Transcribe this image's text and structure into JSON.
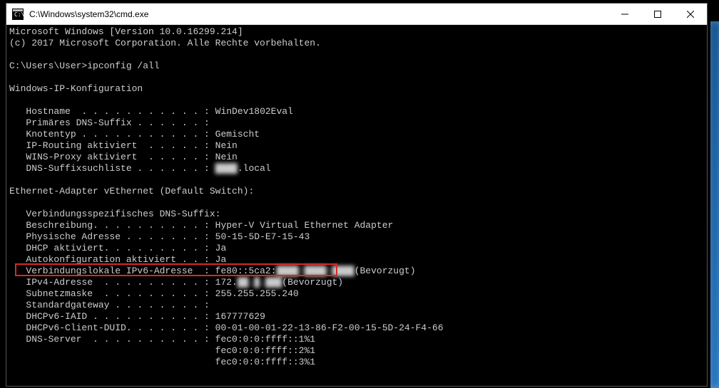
{
  "window": {
    "title": "C:\\Windows\\system32\\cmd.exe"
  },
  "console": {
    "header1": "Microsoft Windows [Version 10.0.16299.214]",
    "header2": "(c) 2017 Microsoft Corporation. Alle Rechte vorbehalten.",
    "prompt_line": "C:\\Users\\User>ipconfig /all",
    "section1_title": "Windows-IP-Konfiguration",
    "hostname_label": "   Hostname  . . . . . . . . . . . : ",
    "hostname_value": "WinDev1802Eval",
    "dns_suffix_label": "   Primäres DNS-Suffix . . . . . . :",
    "nodetype_label": "   Knotentyp . . . . . . . . . . . : ",
    "nodetype_value": "Gemischt",
    "iprouting_label": "   IP-Routing aktiviert  . . . . . : ",
    "iprouting_value": "Nein",
    "winsproxy_label": "   WINS-Proxy aktiviert  . . . . . : ",
    "winsproxy_value": "Nein",
    "dnssuffixlist_label": "   DNS-Suffixsuchliste . . . . . . : ",
    "dnssuffixlist_blur": "████",
    "dnssuffixlist_value": ".local",
    "section2_title": "Ethernet-Adapter vEthernet (Default Switch):",
    "connspec_label": "   Verbindungsspezifisches DNS-Suffix:",
    "desc_label": "   Beschreibung. . . . . . . . . . : ",
    "desc_value": "Hyper-V Virtual Ethernet Adapter",
    "physaddr_label": "   Physische Adresse . . . . . . . : ",
    "physaddr_value": "50-15-5D-E7-15-43",
    "dhcp_label": "   DHCP aktiviert. . . . . . . . . : ",
    "dhcp_value": "Ja",
    "autoconf_label": "   Autokonfiguration aktiviert . . : ",
    "autoconf_value": "Ja",
    "ipv6_label": "   Verbindungslokale IPv6-Adresse  : ",
    "ipv6_prefix": "fe80::5ca2:",
    "ipv6_blur": "████:████:████",
    "ipv6_suffix": "(Bevorzugt)",
    "ipv4_label": "   IPv4-Adresse  . . . . . . . . . : ",
    "ipv4_prefix": "172.",
    "ipv4_blur": "██.█.███",
    "ipv4_suffix": "(Bevorzugt)",
    "subnet_label": "   Subnetzmaske  . . . . . . . . . : ",
    "subnet_value": "255.255.255.240",
    "gateway_label": "   Standardgateway . . . . . . . . :",
    "iaid_label": "   DHCPv6-IAID . . . . . . . . . . : ",
    "iaid_value": "167777629",
    "duid_label": "   DHCPv6-Client-DUID. . . . . . . : ",
    "duid_value": "00-01-00-01-22-13-86-F2-00-15-5D-24-F4-66",
    "dnsserver_label": "   DNS-Server  . . . . . . . . . . : ",
    "dnsserver1": "fec0:0:0:ffff::1%1",
    "dnsserver2_pad": "                                     ",
    "dnsserver2": "fec0:0:0:ffff::2%1",
    "dnsserver3_pad": "                                     ",
    "dnsserver3": "fec0:0:0:ffff::3%1"
  }
}
